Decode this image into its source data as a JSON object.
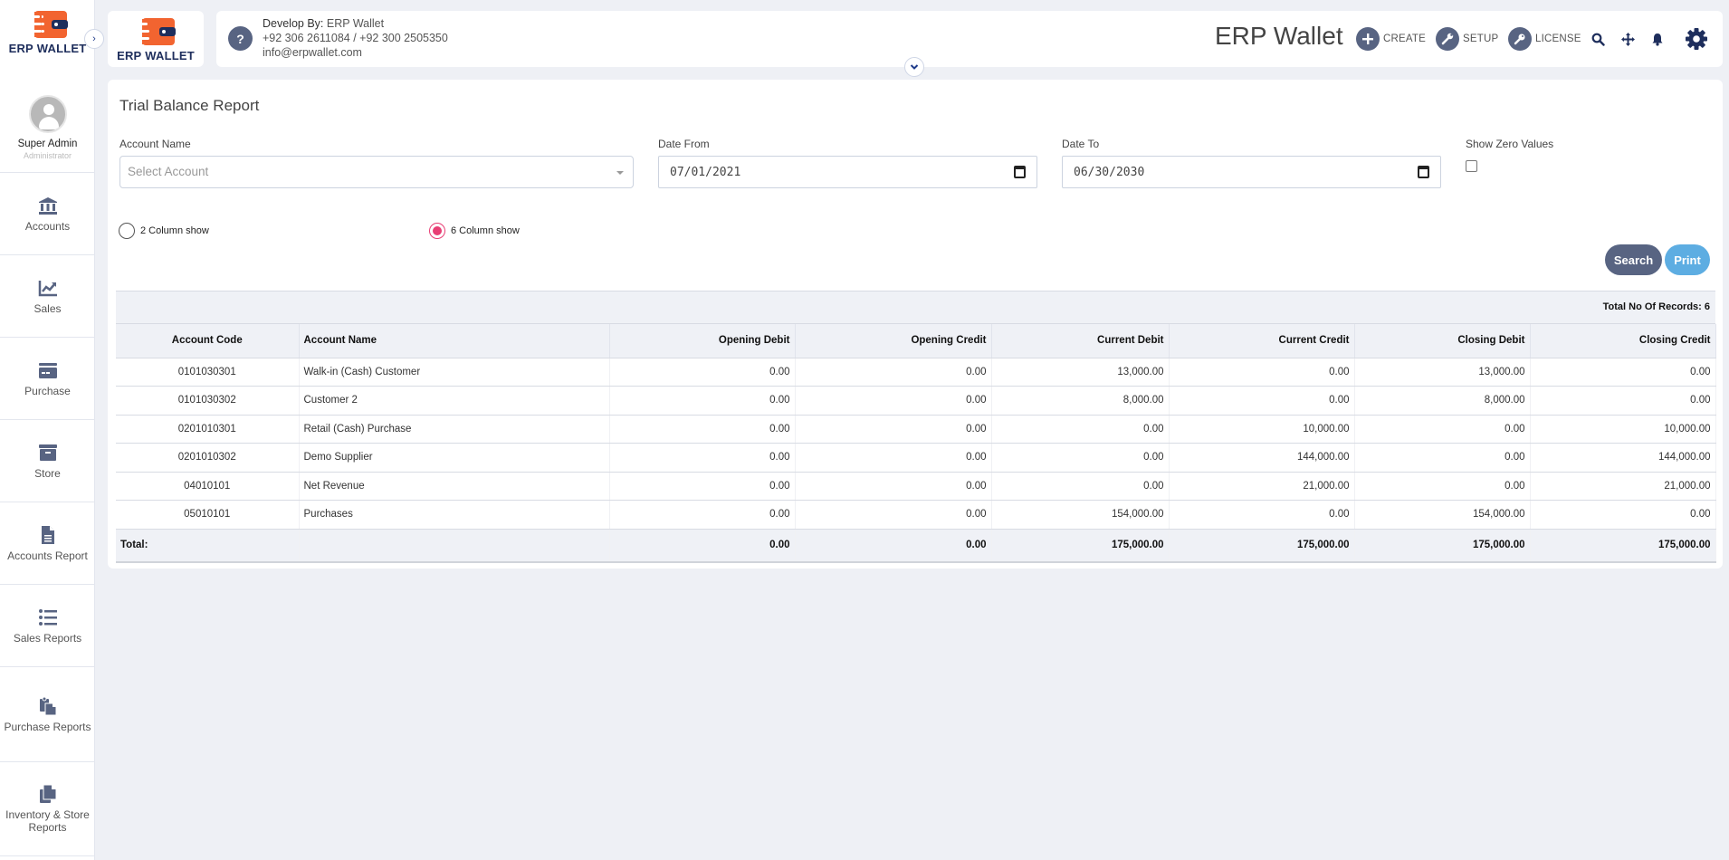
{
  "brand": {
    "logo_text_bold": "ERP",
    "logo_text_rest": " WALLET",
    "colors": {
      "orange": "#f26430",
      "navy": "#1e2e5c",
      "accent": "#586482",
      "radio": "#e83e74",
      "print": "#5dade2"
    }
  },
  "sidebar": {
    "user": {
      "name": "Super Admin",
      "role": "Administrator"
    },
    "items": [
      {
        "label": "Accounts",
        "icon": "bank-icon"
      },
      {
        "label": "Sales",
        "icon": "chart-line-icon"
      },
      {
        "label": "Purchase",
        "icon": "credit-card-icon"
      },
      {
        "label": "Store",
        "icon": "archive-box-icon"
      },
      {
        "label": "Accounts Report",
        "icon": "file-icon"
      },
      {
        "label": "Sales Reports",
        "icon": "list-icon"
      },
      {
        "label": "Purchase Reports",
        "icon": "paste-icon"
      },
      {
        "label": "Inventory & Store Reports",
        "icon": "copy-icon"
      }
    ]
  },
  "header": {
    "developer_label": "Develop By:",
    "developer_name": "ERP Wallet",
    "phones": "+92 306 2611084 / +92 300 2505350",
    "email": "info@erpwallet.com",
    "app_title": "ERP Wallet",
    "buttons": {
      "create": "CREATE",
      "setup": "SETUP",
      "license": "LICENSE"
    }
  },
  "report": {
    "title": "Trial Balance Report",
    "filters": {
      "account_label": "Account Name",
      "account_placeholder": "Select Account",
      "date_from_label": "Date From",
      "date_from_value": "07/01/2021",
      "date_to_label": "Date To",
      "date_to_value": "06/30/2030",
      "zero_label": "Show Zero Values",
      "show_zero": false
    },
    "radios": {
      "two_col": "2 Column show",
      "six_col": "6 Column show",
      "selected": "6 Column show"
    },
    "buttons": {
      "search": "Search",
      "print": "Print"
    },
    "records_label": "Total No Of Records: 6",
    "columns": [
      "Account Code",
      "Account Name",
      "Opening Debit",
      "Opening Credit",
      "Current Debit",
      "Current Credit",
      "Closing Debit",
      "Closing Credit"
    ],
    "rows": [
      {
        "code": "0101030301",
        "name": "Walk-in (Cash) Customer",
        "opening_debit": "0.00",
        "opening_credit": "0.00",
        "current_debit": "13,000.00",
        "current_credit": "0.00",
        "closing_debit": "13,000.00",
        "closing_credit": "0.00"
      },
      {
        "code": "0101030302",
        "name": "Customer 2",
        "opening_debit": "0.00",
        "opening_credit": "0.00",
        "current_debit": "8,000.00",
        "current_credit": "0.00",
        "closing_debit": "8,000.00",
        "closing_credit": "0.00"
      },
      {
        "code": "0201010301",
        "name": "Retail (Cash) Purchase",
        "opening_debit": "0.00",
        "opening_credit": "0.00",
        "current_debit": "0.00",
        "current_credit": "10,000.00",
        "closing_debit": "0.00",
        "closing_credit": "10,000.00"
      },
      {
        "code": "0201010302",
        "name": "Demo Supplier",
        "opening_debit": "0.00",
        "opening_credit": "0.00",
        "current_debit": "0.00",
        "current_credit": "144,000.00",
        "closing_debit": "0.00",
        "closing_credit": "144,000.00"
      },
      {
        "code": "04010101",
        "name": "Net Revenue",
        "opening_debit": "0.00",
        "opening_credit": "0.00",
        "current_debit": "0.00",
        "current_credit": "21,000.00",
        "closing_debit": "0.00",
        "closing_credit": "21,000.00"
      },
      {
        "code": "05010101",
        "name": "Purchases",
        "opening_debit": "0.00",
        "opening_credit": "0.00",
        "current_debit": "154,000.00",
        "current_credit": "0.00",
        "closing_debit": "154,000.00",
        "closing_credit": "0.00"
      }
    ],
    "total": {
      "label": "Total:",
      "opening_debit": "0.00",
      "opening_credit": "0.00",
      "current_debit": "175,000.00",
      "current_credit": "175,000.00",
      "closing_debit": "175,000.00",
      "closing_credit": "175,000.00"
    }
  }
}
